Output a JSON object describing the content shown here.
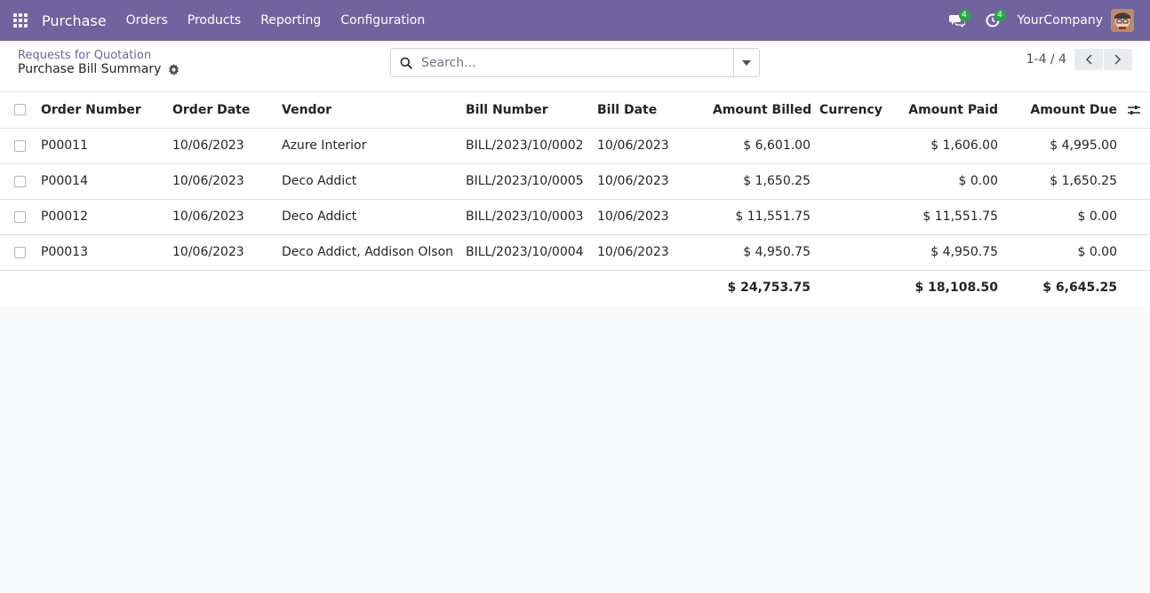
{
  "navbar": {
    "app_name": "Purchase",
    "menu": [
      "Orders",
      "Products",
      "Reporting",
      "Configuration"
    ],
    "messages_count": "4",
    "activities_count": "4",
    "company": "YourCompany",
    "colors": {
      "brand": "#71639e",
      "badge": "#28a745"
    }
  },
  "breadcrumb": {
    "parent": "Requests for Quotation",
    "current": "Purchase Bill Summary"
  },
  "search": {
    "placeholder": "Search..."
  },
  "pager": {
    "value": "1-4 / 4"
  },
  "table": {
    "columns": [
      "Order Number",
      "Order Date",
      "Vendor",
      "Bill Number",
      "Bill Date",
      "Amount Billed",
      "Currency",
      "Amount Paid",
      "Amount Due"
    ],
    "rows": [
      {
        "order": "P00011",
        "order_date": "10/06/2023",
        "vendor": "Azure Interior",
        "bill": "BILL/2023/10/0002",
        "bill_date": "10/06/2023",
        "billed": "$ 6,601.00",
        "currency": "",
        "paid": "$ 1,606.00",
        "due": "$ 4,995.00"
      },
      {
        "order": "P00014",
        "order_date": "10/06/2023",
        "vendor": "Deco Addict",
        "bill": "BILL/2023/10/0005",
        "bill_date": "10/06/2023",
        "billed": "$ 1,650.25",
        "currency": "",
        "paid": "$ 0.00",
        "due": "$ 1,650.25"
      },
      {
        "order": "P00012",
        "order_date": "10/06/2023",
        "vendor": "Deco Addict",
        "bill": "BILL/2023/10/0003",
        "bill_date": "10/06/2023",
        "billed": "$ 11,551.75",
        "currency": "",
        "paid": "$ 11,551.75",
        "due": "$ 0.00"
      },
      {
        "order": "P00013",
        "order_date": "10/06/2023",
        "vendor": "Deco Addict, Addison Olson",
        "bill": "BILL/2023/10/0004",
        "bill_date": "10/06/2023",
        "billed": "$ 4,950.75",
        "currency": "",
        "paid": "$ 4,950.75",
        "due": "$ 0.00"
      }
    ],
    "totals": {
      "billed": "$ 24,753.75",
      "paid": "$ 18,108.50",
      "due": "$ 6,645.25"
    }
  }
}
